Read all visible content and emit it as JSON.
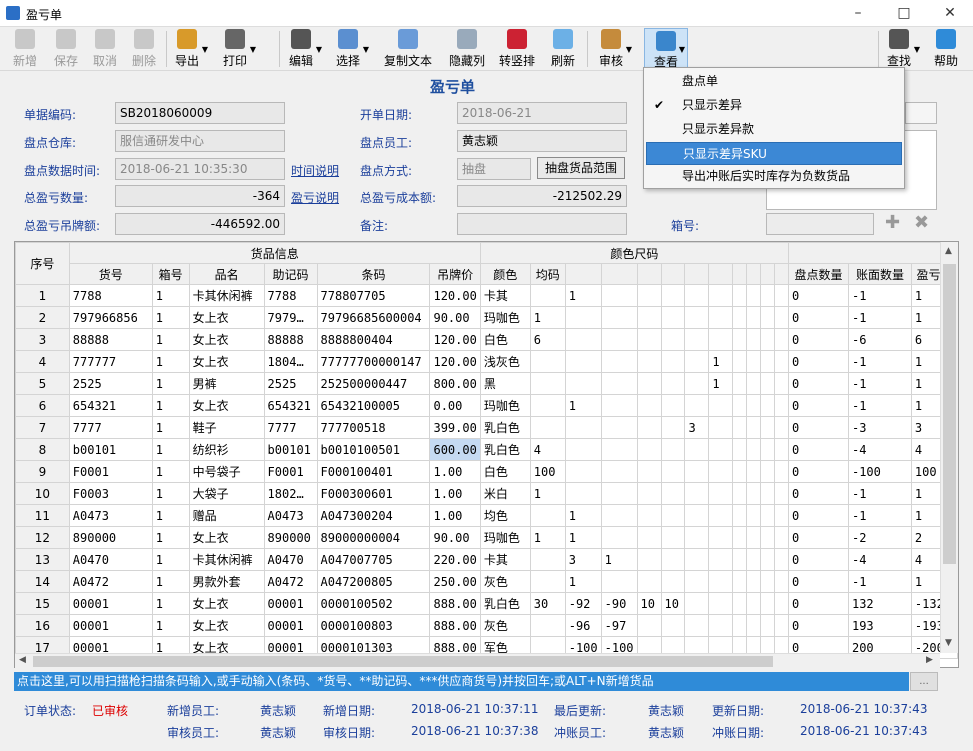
{
  "window": {
    "title": "盈亏单"
  },
  "toolbar": {
    "add": "新增",
    "save": "保存",
    "cancel": "取消",
    "delete": "删除",
    "export": "导出",
    "print": "打印",
    "edit": "编辑",
    "select": "选择",
    "copy_text": "复制文本",
    "hide_col": "隐藏列",
    "transpose": "转竖排",
    "refresh": "刷新",
    "audit": "审核",
    "view": "查看",
    "find": "查找",
    "help": "帮助"
  },
  "page_title": "盈亏单",
  "form": {
    "doc_no_label": "单据编码:",
    "doc_no": "SB2018060009",
    "warehouse_label": "盘点仓库:",
    "warehouse": "服信通研发中心",
    "stocktake_time_label": "盘点数据时间:",
    "stocktake_time": "2018-06-21 10:35:30",
    "time_desc_label": "时间说明",
    "total_qty_label": "总盈亏数量:",
    "total_qty": "-364",
    "pl_desc_label": "盈亏说明",
    "total_tag_label": "总盈亏吊牌额:",
    "total_tag": "-446592.00",
    "open_date_label": "开单日期:",
    "open_date": "2018-06-21",
    "staff_label": "盘点员工:",
    "staff": "黄志颖",
    "method_label": "盘点方式:",
    "method": "抽盘",
    "range_button": "抽盘货品范围",
    "total_cost_label": "总盈亏成本额:",
    "total_cost": "-212502.29",
    "remark_label": "备注:",
    "remark": "",
    "box_label": "箱号:"
  },
  "view_menu": {
    "items": [
      "盘点单",
      "只显示差异",
      "只显示差异款",
      "只显示差异SKU",
      "导出冲账后实时库存为负数货品"
    ]
  },
  "grid": {
    "group_goods": "货品信息",
    "group_color": "颜色尺码",
    "col_seq": "序号",
    "headers": [
      "货号",
      "箱号",
      "品名",
      "助记码",
      "条码",
      "吊牌价",
      "颜色",
      "均码"
    ],
    "right_headers": [
      "盘点数量",
      "账面数量",
      "盈亏数"
    ],
    "rows": [
      {
        "seq": "1",
        "code": "7788",
        "box": "1",
        "name": "卡其休闲裤",
        "mnem": "7788",
        "barcode": "778807705",
        "price": "120.00",
        "color": "卡其",
        "s1": "",
        "s2": "1",
        "s3": "",
        "s4": "",
        "s5": "",
        "s6": "",
        "s7": "",
        "count": "0",
        "book": "-1",
        "diff": "1"
      },
      {
        "seq": "2",
        "code": "797966856",
        "box": "1",
        "name": "女上衣",
        "mnem": "7979…",
        "barcode": "79796685600004",
        "price": "90.00",
        "color": "玛咖色",
        "s1": "1",
        "s2": "",
        "s3": "",
        "s4": "",
        "s5": "",
        "s6": "",
        "s7": "",
        "count": "0",
        "book": "-1",
        "diff": "1"
      },
      {
        "seq": "3",
        "code": "88888",
        "box": "1",
        "name": "女上衣",
        "mnem": "88888",
        "barcode": "8888800404",
        "price": "120.00",
        "color": "白色",
        "s1": "6",
        "s2": "",
        "s3": "",
        "s4": "",
        "s5": "",
        "s6": "",
        "s7": "",
        "count": "0",
        "book": "-6",
        "diff": "6"
      },
      {
        "seq": "4",
        "code": "777777",
        "box": "1",
        "name": "女上衣",
        "mnem": "1804…",
        "barcode": "77777700000147",
        "price": "120.00",
        "color": "浅灰色",
        "s1": "",
        "s2": "",
        "s3": "",
        "s4": "",
        "s5": "",
        "s6": "",
        "s7": "1",
        "count": "0",
        "book": "-1",
        "diff": "1"
      },
      {
        "seq": "5",
        "code": "2525",
        "box": "1",
        "name": "男裤",
        "mnem": "2525",
        "barcode": "252500000447",
        "price": "800.00",
        "color": "黑",
        "s1": "",
        "s2": "",
        "s3": "",
        "s4": "",
        "s5": "",
        "s6": "",
        "s7": "1",
        "count": "0",
        "book": "-1",
        "diff": "1"
      },
      {
        "seq": "6",
        "code": "654321",
        "box": "1",
        "name": "女上衣",
        "mnem": "654321",
        "barcode": "65432100005",
        "price": "0.00",
        "color": "玛咖色",
        "s1": "",
        "s2": "1",
        "s3": "",
        "s4": "",
        "s5": "",
        "s6": "",
        "s7": "",
        "count": "0",
        "book": "-1",
        "diff": "1"
      },
      {
        "seq": "7",
        "code": "7777",
        "box": "1",
        "name": "鞋子",
        "mnem": "7777",
        "barcode": "777700518",
        "price": "399.00",
        "color": "乳白色",
        "s1": "",
        "s2": "",
        "s3": "",
        "s4": "",
        "s5": "",
        "s6": "3",
        "s7": "",
        "count": "0",
        "book": "-3",
        "diff": "3"
      },
      {
        "seq": "8",
        "code": "b00101",
        "box": "1",
        "name": "纺织衫",
        "mnem": "b00101",
        "barcode": "b0010100501",
        "price": "600.00",
        "color": "乳白色",
        "s1": "4",
        "s2": "",
        "s3": "",
        "s4": "",
        "s5": "",
        "s6": "",
        "s7": "",
        "count": "0",
        "book": "-4",
        "diff": "4"
      },
      {
        "seq": "9",
        "code": "F0001",
        "box": "1",
        "name": "中号袋子",
        "mnem": "F0001",
        "barcode": "F000100401",
        "price": "1.00",
        "color": "白色",
        "s1": "100",
        "s2": "",
        "s3": "",
        "s4": "",
        "s5": "",
        "s6": "",
        "s7": "",
        "count": "0",
        "book": "-100",
        "diff": "100"
      },
      {
        "seq": "10",
        "code": "F0003",
        "box": "1",
        "name": "大袋子",
        "mnem": "1802…",
        "barcode": "F000300601",
        "price": "1.00",
        "color": "米白",
        "s1": "1",
        "s2": "",
        "s3": "",
        "s4": "",
        "s5": "",
        "s6": "",
        "s7": "",
        "count": "0",
        "book": "-1",
        "diff": "1"
      },
      {
        "seq": "11",
        "code": "A0473",
        "box": "1",
        "name": "赠品",
        "mnem": "A0473",
        "barcode": "A047300204",
        "price": "1.00",
        "color": "均色",
        "s1": "",
        "s2": "1",
        "s3": "",
        "s4": "",
        "s5": "",
        "s6": "",
        "s7": "",
        "count": "0",
        "book": "-1",
        "diff": "1"
      },
      {
        "seq": "12",
        "code": "890000",
        "box": "1",
        "name": "女上衣",
        "mnem": "890000",
        "barcode": "89000000004",
        "price": "90.00",
        "color": "玛咖色",
        "s1": "1",
        "s2": "1",
        "s3": "",
        "s4": "",
        "s5": "",
        "s6": "",
        "s7": "",
        "count": "0",
        "book": "-2",
        "diff": "2"
      },
      {
        "seq": "13",
        "code": "A0470",
        "box": "1",
        "name": "卡其休闲裤",
        "mnem": "A0470",
        "barcode": "A047007705",
        "price": "220.00",
        "color": "卡其",
        "s1": "",
        "s2": "3",
        "s3": "1",
        "s4": "",
        "s5": "",
        "s6": "",
        "s7": "",
        "count": "0",
        "book": "-4",
        "diff": "4"
      },
      {
        "seq": "14",
        "code": "A0472",
        "box": "1",
        "name": "男款外套",
        "mnem": "A0472",
        "barcode": "A047200805",
        "price": "250.00",
        "color": "灰色",
        "s1": "",
        "s2": "1",
        "s3": "",
        "s4": "",
        "s5": "",
        "s6": "",
        "s7": "",
        "count": "0",
        "book": "-1",
        "diff": "1"
      },
      {
        "seq": "15",
        "code": "00001",
        "box": "1",
        "name": "女上衣",
        "mnem": "00001",
        "barcode": "0000100502",
        "price": "888.00",
        "color": "乳白色",
        "s1": "30",
        "s2": "-92",
        "s3": "-90",
        "s4": "10",
        "s5": "10",
        "s6": "",
        "s7": "",
        "count": "0",
        "book": "132",
        "diff": "-132"
      },
      {
        "seq": "16",
        "code": "00001",
        "box": "1",
        "name": "女上衣",
        "mnem": "00001",
        "barcode": "0000100803",
        "price": "888.00",
        "color": "灰色",
        "s1": "",
        "s2": "-96",
        "s3": "-97",
        "s4": "",
        "s5": "",
        "s6": "",
        "s7": "",
        "count": "0",
        "book": "193",
        "diff": "-193"
      },
      {
        "seq": "17",
        "code": "00001",
        "box": "1",
        "name": "女上衣",
        "mnem": "00001",
        "barcode": "0000101303",
        "price": "888.00",
        "color": "军色",
        "s1": "",
        "s2": "-100",
        "s3": "-100",
        "s4": "",
        "s5": "",
        "s6": "",
        "s7": "",
        "count": "0",
        "book": "200",
        "diff": "-200"
      }
    ]
  },
  "hint": "点击这里,可以用扫描枪扫描条码输入,或手动输入(条码、*货号、**助记码、***供应商货号)并按回车;或ALT+N新增货品",
  "hint_btn": "...",
  "status": {
    "order_state_label": "订单状态:",
    "order_state": "已审核",
    "add_staff_label": "新增员工:",
    "add_staff": "黄志颖",
    "add_date_label": "新增日期:",
    "add_date": "2018-06-21 10:37:11",
    "last_update_label": "最后更新:",
    "last_update": "黄志颖",
    "update_date_label": "更新日期:",
    "update_date": "2018-06-21 10:37:43",
    "audit_staff_label": "审核员工:",
    "audit_staff": "黄志颖",
    "audit_date_label": "审核日期:",
    "audit_date": "2018-06-21 10:37:38",
    "writeoff_staff_label": "冲账员工:",
    "writeoff_staff": "黄志颖",
    "writeoff_date_label": "冲账日期:",
    "writeoff_date": "2018-06-21 10:37:43"
  },
  "colors": {
    "accent": "#1b3f9b",
    "highlight": "#3c88d5",
    "hint_bar": "#2f8bd8",
    "status_red": "#dd0000"
  }
}
